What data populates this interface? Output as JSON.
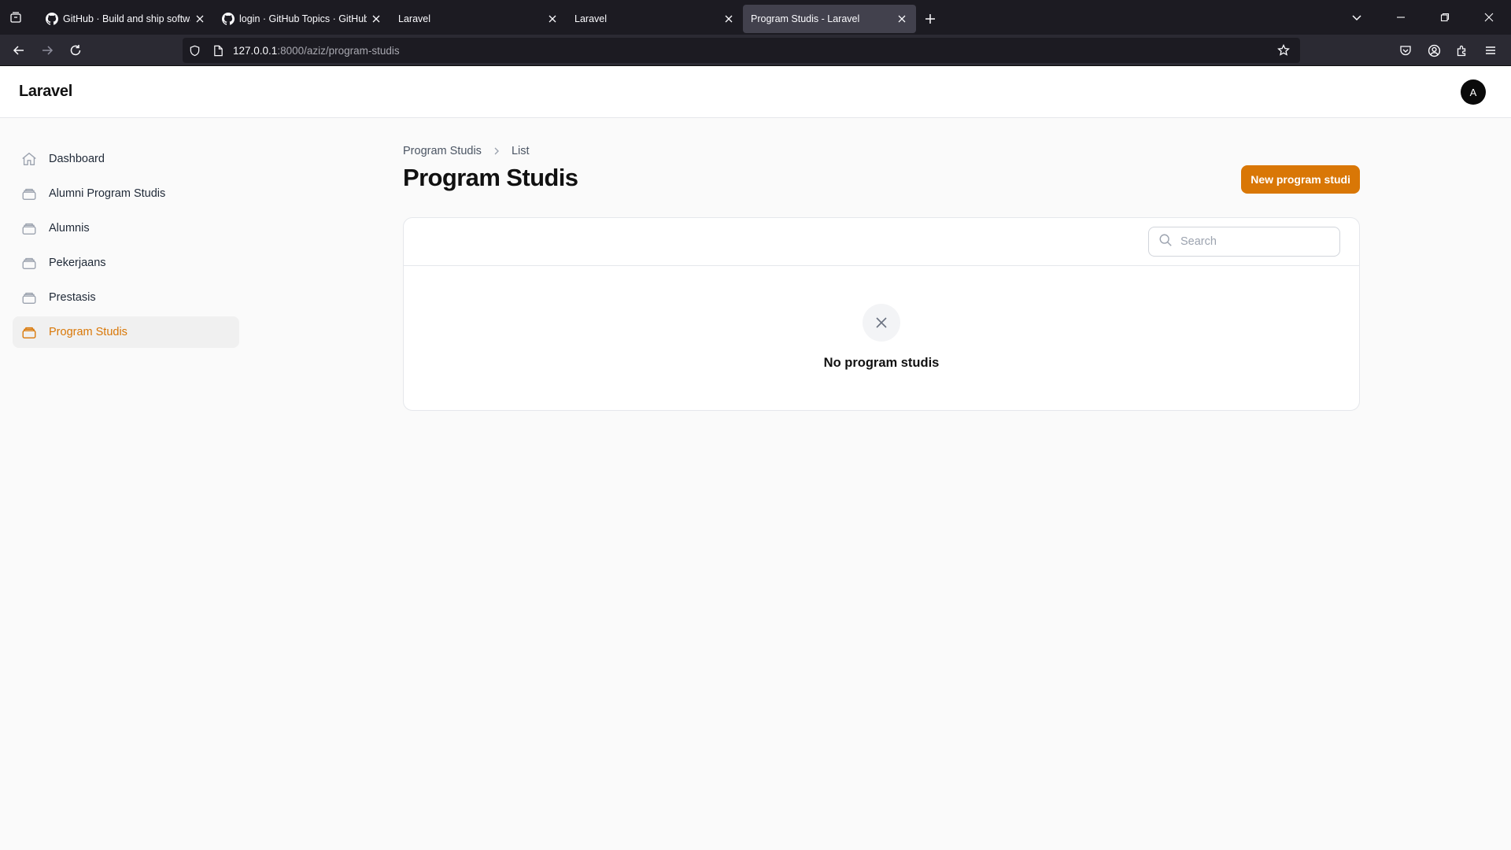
{
  "browser": {
    "tabs": [
      {
        "title": "GitHub · Build and ship software",
        "icon": "github-icon",
        "active": false
      },
      {
        "title": "login · GitHub Topics · GitHub",
        "icon": "github-icon",
        "active": false
      },
      {
        "title": "Laravel",
        "icon": "",
        "active": false
      },
      {
        "title": "Laravel",
        "icon": "",
        "active": false
      },
      {
        "title": "Program Studis - Laravel",
        "icon": "",
        "active": true
      }
    ],
    "url_host": "127.0.0.1",
    "url_rest": ":8000/aziz/program-studis"
  },
  "app": {
    "brand": "Laravel",
    "avatar_initial": "A",
    "accent_color": "#d97706"
  },
  "sidebar": {
    "items": [
      {
        "label": "Dashboard",
        "icon": "home-icon"
      },
      {
        "label": "Alumni Program Studis",
        "icon": "collection-icon"
      },
      {
        "label": "Alumnis",
        "icon": "collection-icon"
      },
      {
        "label": "Pekerjaans",
        "icon": "collection-icon"
      },
      {
        "label": "Prestasis",
        "icon": "collection-icon"
      },
      {
        "label": "Program Studis",
        "icon": "collection-icon",
        "active": true
      }
    ]
  },
  "main": {
    "breadcrumb": [
      "Program Studis",
      "List"
    ],
    "title": "Program Studis",
    "new_button": "New program studi",
    "search_placeholder": "Search",
    "empty_text": "No program studis"
  }
}
